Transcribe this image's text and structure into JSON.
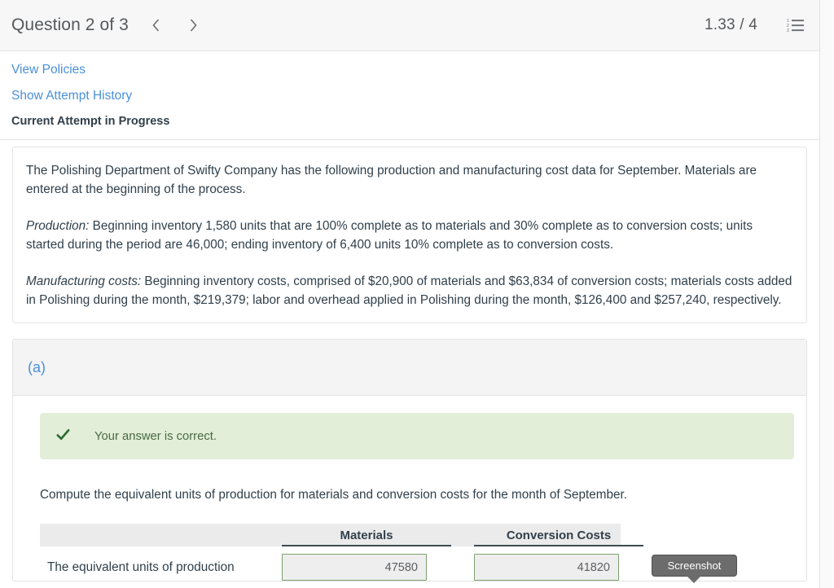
{
  "header": {
    "title": "Question 2 of 3",
    "prev_icon": "chevron-left-icon",
    "next_icon": "chevron-right-icon",
    "score": "1.33 / 4",
    "list_icon": "numbered-list-icon"
  },
  "links": {
    "view_policies": "View Policies",
    "show_attempt_history": "Show Attempt History",
    "current_attempt": "Current Attempt in Progress"
  },
  "problem": {
    "intro_p1": "The Polishing Department of Swifty Company has the following production and manufacturing cost data for September. Materials are entered at the beginning of the process.",
    "production_label": "Production:",
    "production_text": " Beginning inventory 1,580 units that are 100% complete as to materials and 30% complete as to conversion costs; units started during the period are 46,000; ending inventory of 6,400 units 10% complete as to conversion costs.",
    "manufacturing_label": "Manufacturing costs:",
    "manufacturing_text": " Beginning inventory costs, comprised of $20,900 of materials and $63,834 of conversion costs; materials costs added in Polishing during the month, $219,379; labor and overhead applied in Polishing during the month, $126,400 and $257,240, respectively."
  },
  "part_a": {
    "letter": "(a)",
    "banner": {
      "icon": "check-icon",
      "text": "Your answer is correct.",
      "bg_color": "#e2eed8",
      "text_color": "#4a6a44"
    },
    "instruction": "Compute the equivalent units of production for materials and conversion costs for the month of September.",
    "table": {
      "headers": [
        "",
        "Materials",
        "Conversion Costs"
      ],
      "rows": [
        {
          "label": "The equivalent units of production",
          "materials_value": "47580",
          "conversion_value": "41820"
        }
      ]
    }
  },
  "tooltip": {
    "label": "Screenshot"
  },
  "colors": {
    "link_blue": "#4a90d9",
    "input_border_green": "#7da06e",
    "header_bg": "#f7f7f8"
  }
}
